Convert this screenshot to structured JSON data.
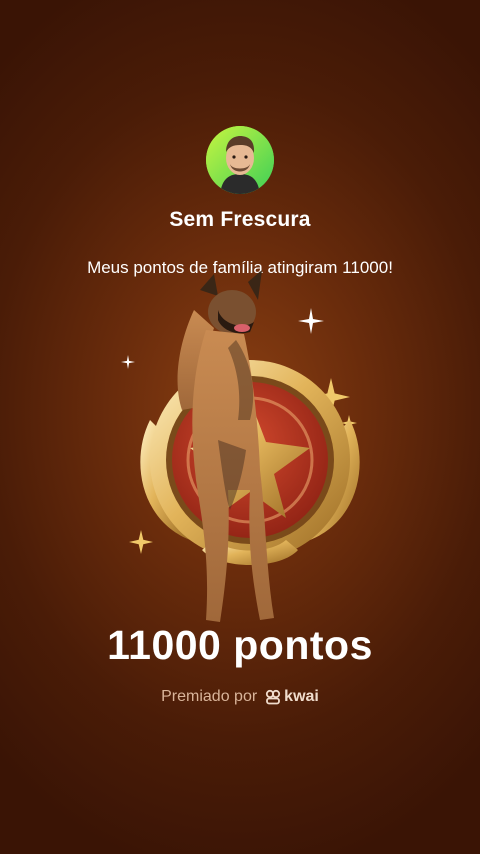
{
  "profile": {
    "name": "Sem Frescura",
    "avatar_icon": "person-avatar-icon"
  },
  "message": "Meus pontos de família atingiram 11000!",
  "achievement": {
    "points_label": "11000 pontos",
    "badge_icon": "gold-star-badge-icon"
  },
  "footer": {
    "awarded_by": "Premiado por",
    "brand": "kwai",
    "brand_icon": "kwai-logo-icon"
  },
  "colors": {
    "background": "#5a220a",
    "gold": "#e7c06a",
    "badge_red": "#b8321e",
    "avatar_ring": "#7fe13f"
  }
}
